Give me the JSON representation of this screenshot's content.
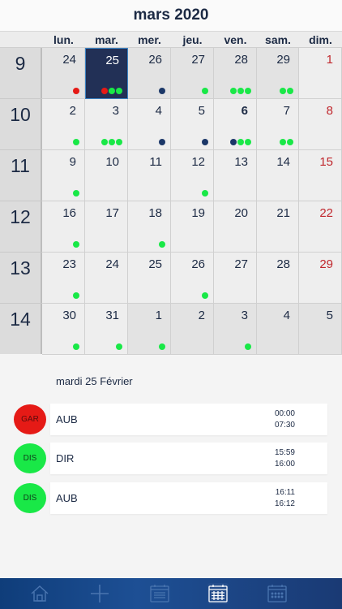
{
  "header": {
    "title": "mars 2020"
  },
  "weekdays": [
    "lun.",
    "mar.",
    "mer.",
    "jeu.",
    "ven.",
    "sam.",
    "dim."
  ],
  "colors": {
    "green": "#19e847",
    "red": "#e51a16",
    "navy": "#1b3768",
    "sunday": "#c0272d",
    "selected": "#223056"
  },
  "weeks": [
    {
      "number": "9",
      "days": [
        {
          "day": "24",
          "other": true,
          "dots": [
            "red"
          ]
        },
        {
          "day": "25",
          "other": true,
          "selected": true,
          "dots": [
            "red",
            "green",
            "green"
          ]
        },
        {
          "day": "26",
          "other": true,
          "dots": [
            "navy"
          ]
        },
        {
          "day": "27",
          "other": true,
          "dots": [
            "green"
          ]
        },
        {
          "day": "28",
          "other": true,
          "dots": [
            "green",
            "green",
            "green"
          ]
        },
        {
          "day": "29",
          "other": true,
          "dots": [
            "green",
            "green"
          ]
        },
        {
          "day": "1",
          "sunday": true,
          "dots": []
        }
      ]
    },
    {
      "number": "10",
      "days": [
        {
          "day": "2",
          "dots": [
            "green"
          ]
        },
        {
          "day": "3",
          "dots": [
            "green",
            "green",
            "green"
          ]
        },
        {
          "day": "4",
          "dots": [
            "navy"
          ]
        },
        {
          "day": "5",
          "dots": [
            "navy"
          ]
        },
        {
          "day": "6",
          "bold": true,
          "dots": [
            "navy",
            "green",
            "green"
          ]
        },
        {
          "day": "7",
          "dots": [
            "green",
            "green"
          ]
        },
        {
          "day": "8",
          "sunday": true,
          "dots": []
        }
      ]
    },
    {
      "number": "11",
      "days": [
        {
          "day": "9",
          "dots": [
            "green"
          ]
        },
        {
          "day": "10",
          "dots": []
        },
        {
          "day": "11",
          "dots": []
        },
        {
          "day": "12",
          "dots": [
            "green"
          ]
        },
        {
          "day": "13",
          "dots": []
        },
        {
          "day": "14",
          "dots": []
        },
        {
          "day": "15",
          "sunday": true,
          "dots": []
        }
      ]
    },
    {
      "number": "12",
      "days": [
        {
          "day": "16",
          "dots": [
            "green"
          ]
        },
        {
          "day": "17",
          "dots": []
        },
        {
          "day": "18",
          "dots": [
            "green"
          ]
        },
        {
          "day": "19",
          "dots": []
        },
        {
          "day": "20",
          "dots": []
        },
        {
          "day": "21",
          "dots": []
        },
        {
          "day": "22",
          "sunday": true,
          "dots": []
        }
      ]
    },
    {
      "number": "13",
      "days": [
        {
          "day": "23",
          "dots": [
            "green"
          ]
        },
        {
          "day": "24",
          "dots": []
        },
        {
          "day": "25",
          "dots": []
        },
        {
          "day": "26",
          "dots": [
            "green"
          ]
        },
        {
          "day": "27",
          "dots": []
        },
        {
          "day": "28",
          "dots": []
        },
        {
          "day": "29",
          "sunday": true,
          "dots": []
        }
      ]
    },
    {
      "number": "14",
      "days": [
        {
          "day": "30",
          "dots": [
            "green"
          ]
        },
        {
          "day": "31",
          "dots": [
            "green"
          ]
        },
        {
          "day": "1",
          "other": true,
          "dots": [
            "green"
          ]
        },
        {
          "day": "2",
          "other": true,
          "dots": []
        },
        {
          "day": "3",
          "other": true,
          "dots": [
            "green"
          ]
        },
        {
          "day": "4",
          "other": true,
          "dots": []
        },
        {
          "day": "5",
          "other": true,
          "dots": []
        }
      ]
    }
  ],
  "detail": {
    "title": "mardi 25 Février",
    "events": [
      {
        "badge": "GAR",
        "badge_color": "red",
        "code": "AUB",
        "start": "00:00",
        "end": "07:30"
      },
      {
        "badge": "DIS",
        "badge_color": "green",
        "code": "DIR",
        "start": "15:59",
        "end": "16:00"
      },
      {
        "badge": "DIS",
        "badge_color": "green",
        "code": "AUB",
        "start": "16:11",
        "end": "16:12"
      }
    ]
  },
  "tabbar": {
    "tabs": [
      {
        "name": "home-icon"
      },
      {
        "name": "add-icon"
      },
      {
        "name": "list-icon"
      },
      {
        "name": "calendar-month-icon",
        "active": true
      },
      {
        "name": "calendar-grid-icon"
      }
    ]
  }
}
